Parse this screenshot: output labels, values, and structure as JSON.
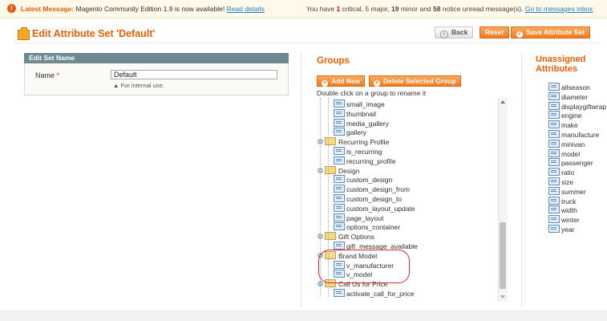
{
  "message_bar": {
    "warn_glyph": "!",
    "latest_label": "Latest Message:",
    "latest_text": " Magento Community Edition 1.9 is now available!",
    "read_details": "Read details",
    "summary_pre": "You have ",
    "critical_count": "1",
    "critical_label": " critical",
    "major": ", 5 major, ",
    "minor_count": "19",
    "minor_label": " minor and ",
    "notice_count": "58",
    "notice_label": " notice unread message(s). ",
    "goto_link": "Go to messages inbox"
  },
  "header": {
    "title": "Edit Attribute Set 'Default'",
    "back_label": "Back",
    "reset_label": "Reset",
    "save_label": "Save Attribute Set"
  },
  "edit_set_name": {
    "heading": "Edit Set Name",
    "name_label": "Name",
    "required_mark": "*",
    "name_value": "Default",
    "hint": "For internal use."
  },
  "groups": {
    "title": "Groups",
    "add_new_label": "Add New",
    "delete_label": "Delete Selected Group",
    "hint": "Double click on a group to rename it",
    "tree": [
      {
        "type": "attr",
        "label": "small_image"
      },
      {
        "type": "attr",
        "label": "thumbnail"
      },
      {
        "type": "attr",
        "label": "media_gallery"
      },
      {
        "type": "attr",
        "label": "gallery"
      },
      {
        "type": "group",
        "label": "Recurring Profile"
      },
      {
        "type": "attr",
        "label": "is_recurring"
      },
      {
        "type": "attr",
        "label": "recurring_profile"
      },
      {
        "type": "group",
        "label": "Design"
      },
      {
        "type": "attr",
        "label": "custom_design"
      },
      {
        "type": "attr",
        "label": "custom_design_from"
      },
      {
        "type": "attr",
        "label": "custom_design_to"
      },
      {
        "type": "attr",
        "label": "custom_layout_update"
      },
      {
        "type": "attr",
        "label": "page_layout"
      },
      {
        "type": "attr",
        "label": "options_container"
      },
      {
        "type": "group",
        "label": "Gift Options"
      },
      {
        "type": "attr",
        "label": "gift_message_available"
      },
      {
        "type": "group",
        "label": "Brand Model"
      },
      {
        "type": "attr",
        "label": "v_manufacturer"
      },
      {
        "type": "attr",
        "label": "v_model"
      },
      {
        "type": "group",
        "label": "Call Us for Price"
      },
      {
        "type": "attr",
        "label": "activate_call_for_price"
      }
    ]
  },
  "unassigned": {
    "title_line1": "Unassigned",
    "title_line2": "Attributes",
    "items": [
      "allseason",
      "diameter",
      "displaygiftwrap",
      "engine",
      "make",
      "manufacture",
      "minivan",
      "model",
      "passenger",
      "ratio",
      "size",
      "summer",
      "truck",
      "width",
      "winter",
      "year"
    ]
  },
  "colors": {
    "accent": "#eb5e00",
    "button_orange": "#ef7b20",
    "box_header": "#6f8992",
    "highlight_ring": "#e0262c"
  }
}
